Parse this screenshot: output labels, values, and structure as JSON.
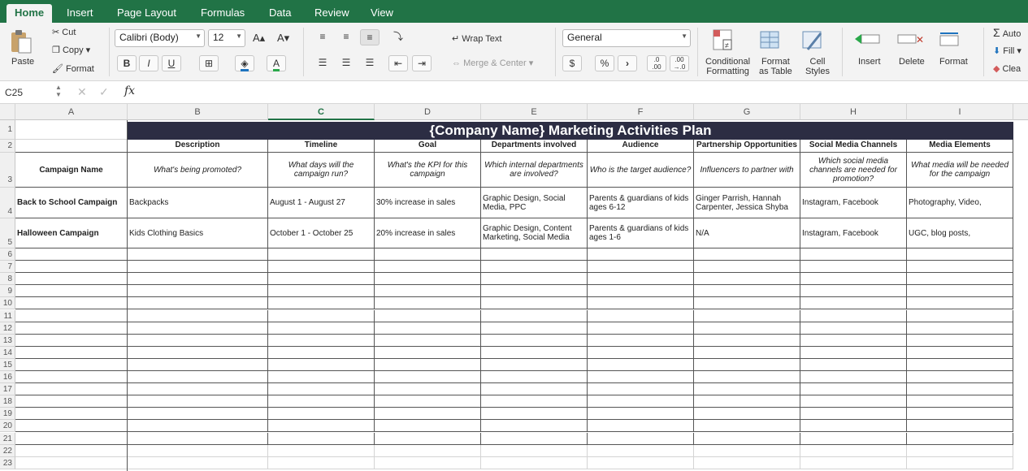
{
  "tabs": [
    "Home",
    "Insert",
    "Page Layout",
    "Formulas",
    "Data",
    "Review",
    "View"
  ],
  "clipboard": {
    "paste": "Paste",
    "cut": "Cut",
    "copy": "Copy",
    "format": "Format"
  },
  "font": {
    "name": "Calibri (Body)",
    "size": "12"
  },
  "alignment": {
    "wrap_text": "Wrap Text",
    "merge_center": "Merge & Center"
  },
  "number": {
    "format": "General",
    "currency": "$",
    "percent": "%",
    "comma": "›",
    "inc_dec": ".0\n.00",
    "dec_dec": ".00\n→.0"
  },
  "styles": {
    "conditional": "Conditional\nFormatting",
    "format_table": "Format\nas Table",
    "cell_styles": "Cell\nStyles"
  },
  "cells_group": {
    "insert": "Insert",
    "delete": "Delete",
    "format": "Format"
  },
  "editing": {
    "autosum": "Auto",
    "fill": "Fill",
    "clear": "Clea"
  },
  "formula_bar": {
    "name_box": "C25",
    "fx": "fx",
    "content": ""
  },
  "columns": [
    "A",
    "B",
    "C",
    "D",
    "E",
    "F",
    "G",
    "H",
    "I"
  ],
  "sheet": {
    "title": "{Company Name} Marketing Activities Plan",
    "headers": [
      "",
      "Description",
      "Timeline",
      "Goal",
      "Departments involved",
      "Audience",
      "Partnership Opportunities",
      "Social Media Channels",
      "Media Elements"
    ],
    "subheaders": [
      "Campaign Name",
      "What's being promoted?",
      "What days will the campaign run?",
      "What's the KPI for this campaign",
      "Which internal departments are involved?",
      "Who is the target audience?",
      "Influencers to partner with",
      "Which social media channels are needed for promotion?",
      "What media will be needed for the campaign"
    ],
    "rows": [
      [
        "Back to School Campaign",
        "Backpacks",
        "August 1 - August 27",
        "30% increase in sales",
        "Graphic Design, Social Media, PPC",
        "Parents & guardians of kids ages 6-12",
        "Ginger Parrish, Hannah Carpenter, Jessica Shyba",
        "Instagram, Facebook",
        "Photography, Video,"
      ],
      [
        "Halloween Campaign",
        "Kids Clothing Basics",
        "October 1 - October 25",
        "20% increase in sales",
        "Graphic Design, Content Marketing, Social Media",
        "Parents & guardians of kids ages 1-6",
        "N/A",
        "Instagram, Facebook",
        "UGC, blog posts,"
      ]
    ],
    "row_numbers": [
      "1",
      "2",
      "3",
      "4",
      "5",
      "6",
      "7",
      "8",
      "9",
      "10",
      "11",
      "12",
      "13",
      "14",
      "15",
      "16",
      "17",
      "18",
      "19",
      "20",
      "21",
      "22",
      "23"
    ]
  },
  "colors": {
    "accent": "#217346",
    "title_bg": "#2c2d43"
  }
}
